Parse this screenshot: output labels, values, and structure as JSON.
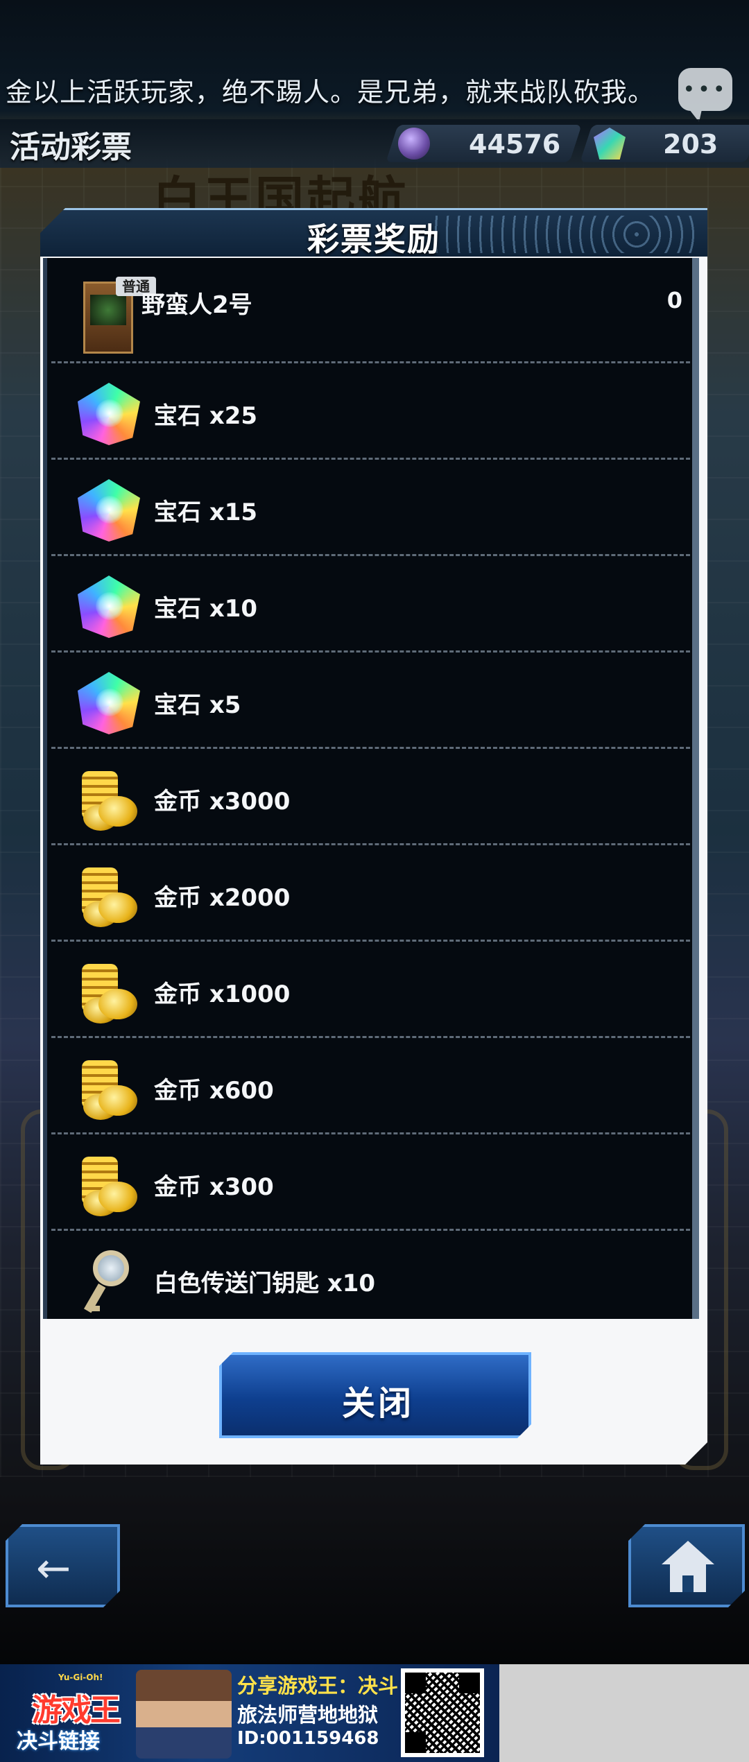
{
  "ticker": {
    "text": "金以上活跃玩家，绝不踢人。是兄弟，就来战队砍我。"
  },
  "header": {
    "title": "活动彩票",
    "gems_value": "44576",
    "crystals_value": "203",
    "background_banner": "白王国起航"
  },
  "modal": {
    "title": "彩票奖励",
    "close_label": "关闭",
    "rewards": [
      {
        "label": "野蛮人2号",
        "count": "0",
        "icon": "card-icon",
        "badge": "普通"
      },
      {
        "label": "宝石 x25",
        "icon": "gem-icon"
      },
      {
        "label": "宝石 x15",
        "icon": "gem-icon"
      },
      {
        "label": "宝石 x10",
        "icon": "gem-icon"
      },
      {
        "label": "宝石 x5",
        "icon": "gem-icon"
      },
      {
        "label": "金币 x3000",
        "icon": "gold-coins-icon"
      },
      {
        "label": "金币 x2000",
        "icon": "gold-coins-icon"
      },
      {
        "label": "金币 x1000",
        "icon": "gold-coins-icon"
      },
      {
        "label": "金币 x600",
        "icon": "gold-coins-icon"
      },
      {
        "label": "金币 x300",
        "icon": "gold-coins-icon"
      },
      {
        "label": "白色传送门钥匙 x10",
        "icon": "white-portal-key-icon"
      }
    ]
  },
  "nav": {
    "back_icon": "back-arrow-icon",
    "home_icon": "home-icon"
  },
  "share_banner": {
    "logo_top": "Yu-Gi-Oh!",
    "logo_main": "游戏王",
    "logo_sub": "决斗链接",
    "line1": "分享游戏王：决斗",
    "line2": "旅法师营地地狱",
    "line3": "ID:001159468"
  },
  "colors": {
    "modal_header": "#0e2238",
    "list_background": "#050a10",
    "close_button": "#0e3f8f",
    "accent_blue": "#6fb3ff"
  }
}
